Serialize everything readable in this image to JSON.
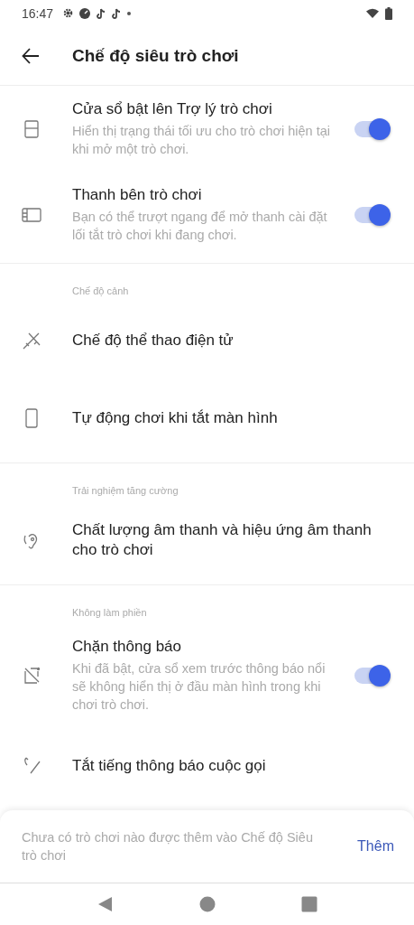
{
  "status_bar": {
    "time": "16:47"
  },
  "header": {
    "title": "Chế độ siêu trò chơi"
  },
  "sections": [
    {
      "items": [
        {
          "kind": "toggle",
          "title": "Cửa sổ bật lên Trợ lý trò chơi",
          "subtitle": "Hiển thị trạng thái tối ưu cho trò chơi hiện tại khi mở một trò chơi.",
          "on": true
        },
        {
          "kind": "toggle",
          "title": "Thanh bên trò chơi",
          "subtitle": "Bạn có thể trượt ngang để mở thanh cài đặt lối tắt trò chơi khi đang chơi.",
          "on": true
        }
      ]
    },
    {
      "heading": "Chế độ cảnh",
      "items": [
        {
          "kind": "link",
          "title": "Chế độ thể thao điện tử"
        },
        {
          "kind": "link",
          "title": "Tự động chơi khi tắt màn hình"
        }
      ]
    },
    {
      "heading": "Trải nghiệm tăng cường",
      "items": [
        {
          "kind": "link",
          "title": "Chất lượng âm thanh và hiệu ứng âm thanh cho trò chơi"
        }
      ]
    },
    {
      "heading": "Không làm phiền",
      "items": [
        {
          "kind": "toggle",
          "title": "Chặn thông báo",
          "subtitle": "Khi đã bật, cửa sổ xem trước thông báo nổi sẽ không hiển thị ở đầu màn hình trong khi chơi trò chơi.",
          "on": true
        },
        {
          "kind": "link",
          "title": "Tắt tiếng thông báo cuộc gọi"
        }
      ]
    }
  ],
  "bottom_sheet": {
    "message": "Chưa có trò chơi nào được thêm vào Chế độ Siêu trò chơi",
    "action": "Thêm"
  }
}
